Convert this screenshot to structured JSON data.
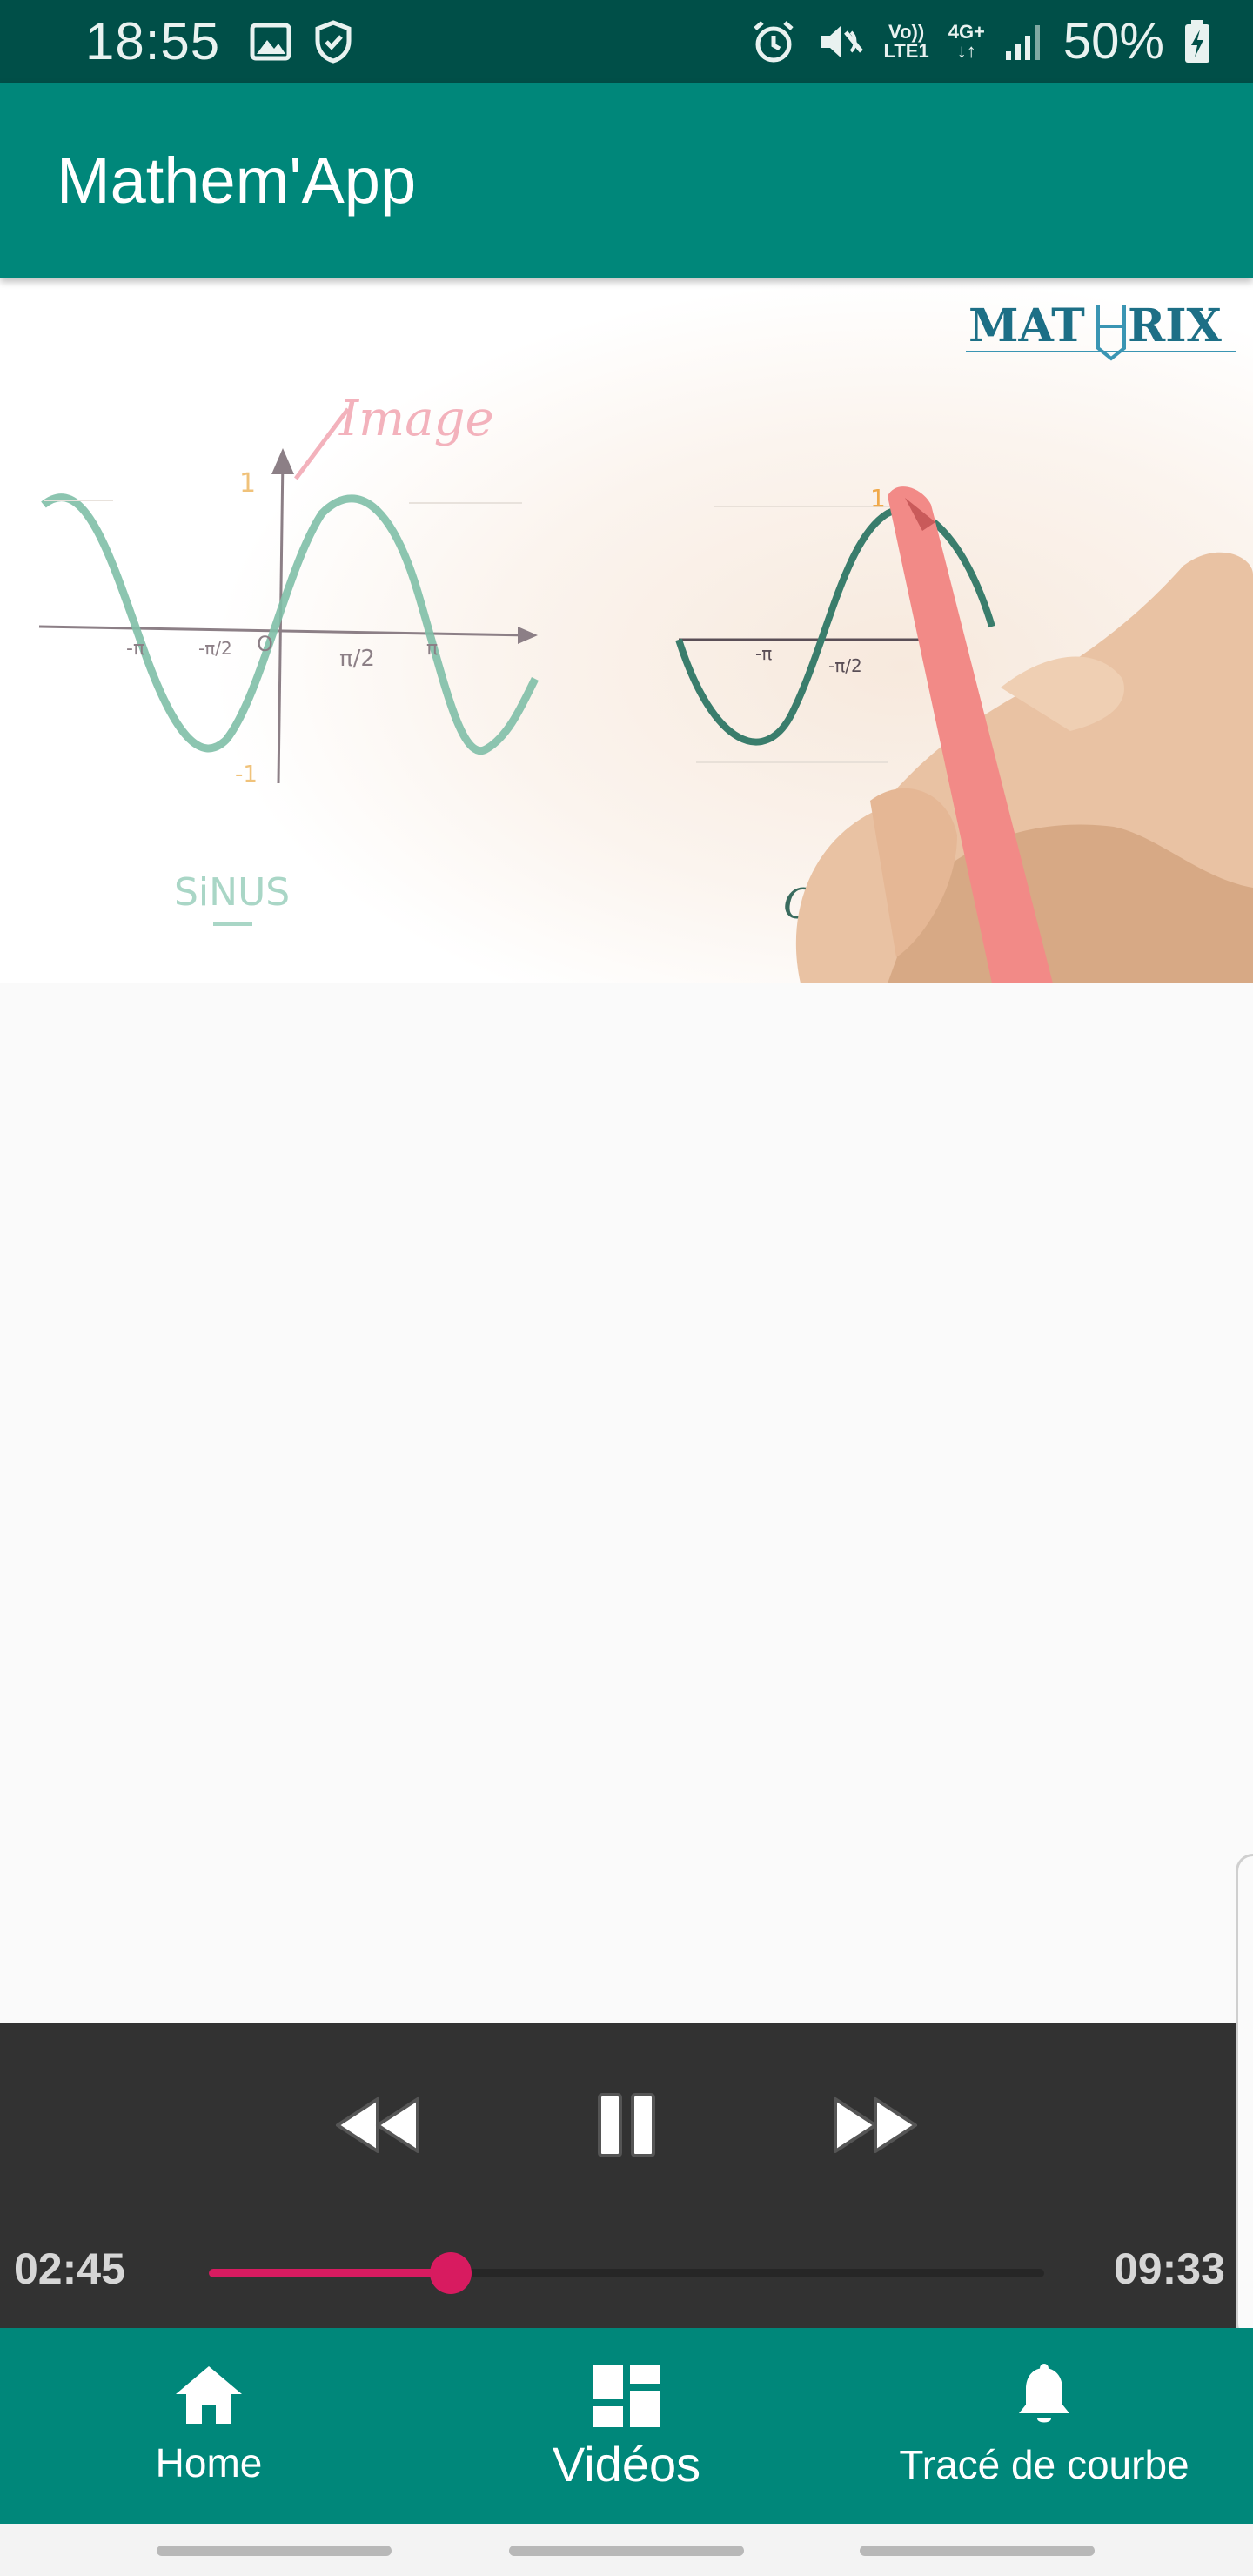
{
  "status_bar": {
    "time": "18:55",
    "volte": "Vo))",
    "lte": "LTE1",
    "network": "4G+",
    "battery": "50%"
  },
  "app_bar": {
    "title": "Mathem'App"
  },
  "video": {
    "logo_left": "MAT",
    "logo_right": "RIX",
    "board_label_sinus": "SiNUS",
    "board_label_cos": "Co",
    "board_word": "Image"
  },
  "player": {
    "current_time": "02:45",
    "total_time": "09:33",
    "progress": 0.29
  },
  "bottom_nav": {
    "items": [
      {
        "label": "Home",
        "icon": "home-icon",
        "active": false
      },
      {
        "label": "Vidéos",
        "icon": "dashboard-icon",
        "active": true
      },
      {
        "label": "Tracé de courbe",
        "icon": "bell-icon",
        "active": false
      }
    ]
  },
  "colors": {
    "primary": "#00877a",
    "status_bar": "#004f48",
    "accent": "#d81b60",
    "player_bg": "#323232"
  }
}
